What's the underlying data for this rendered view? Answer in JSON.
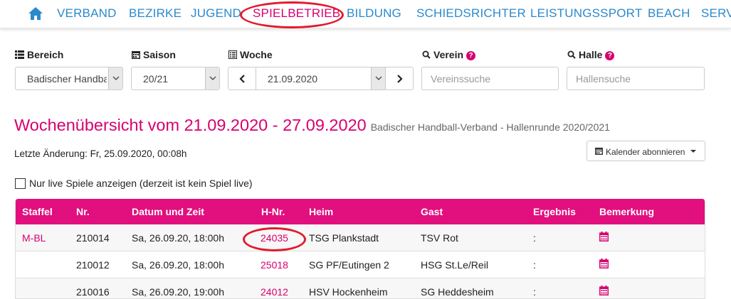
{
  "nav": {
    "items": [
      "VERBAND",
      "BEZIRKE",
      "JUGEND",
      "SPIELBETRIEB",
      "BILDUNG",
      "SCHIEDSRICHTER",
      "LEISTUNGSSPORT",
      "BEACH",
      "SERV"
    ],
    "active": "SPIELBETRIEB"
  },
  "filters": {
    "bereich_label": "Bereich",
    "bereich_value": "Badischer Handba",
    "saison_label": "Saison",
    "saison_value": "20/21",
    "woche_label": "Woche",
    "woche_value": "21.09.2020",
    "verein_label": "Verein",
    "verein_placeholder": "Vereinssuche",
    "halle_label": "Halle",
    "halle_placeholder": "Hallensuche"
  },
  "heading": {
    "title": "Wochenübersicht vom 21.09.2020 - 27.09.2020",
    "subtitle": "Badischer Handball-Verband - Hallenrunde 2020/2021"
  },
  "last_change": "Letzte Änderung: Fr, 25.09.2020, 00:08h",
  "calendar_button": "Kalender abonnieren",
  "live_filter": "Nur live Spiele anzeigen (derzeit ist kein Spiel live)",
  "table": {
    "headers": [
      "Staffel",
      "Nr.",
      "Datum und Zeit",
      "H-Nr.",
      "Heim",
      "Gast",
      "Ergebnis",
      "Bemerkung"
    ],
    "rows": [
      {
        "staffel": "M-BL",
        "nr": "210014",
        "datum": "Sa, 26.09.20, 18:00h",
        "hnr": "24035",
        "heim": "TSG Plankstadt",
        "gast": "TSV Rot",
        "ergebnis": ":"
      },
      {
        "staffel": "",
        "nr": "210012",
        "datum": "Sa, 26.09.20, 18:00h",
        "hnr": "25018",
        "heim": "SG PF/Eutingen 2",
        "gast": "HSG St.Le/Reil",
        "ergebnis": ":"
      },
      {
        "staffel": "",
        "nr": "210016",
        "datum": "Sa, 26.09.20, 19:00h",
        "hnr": "24012",
        "heim": "HSV Hockenheim",
        "gast": "SG Heddesheim",
        "ergebnis": ":"
      }
    ]
  },
  "colors": {
    "accent": "#d6006f",
    "nav_link": "#2a8acb",
    "table_header": "#e20f7e",
    "annotation": "#e21a2c"
  }
}
